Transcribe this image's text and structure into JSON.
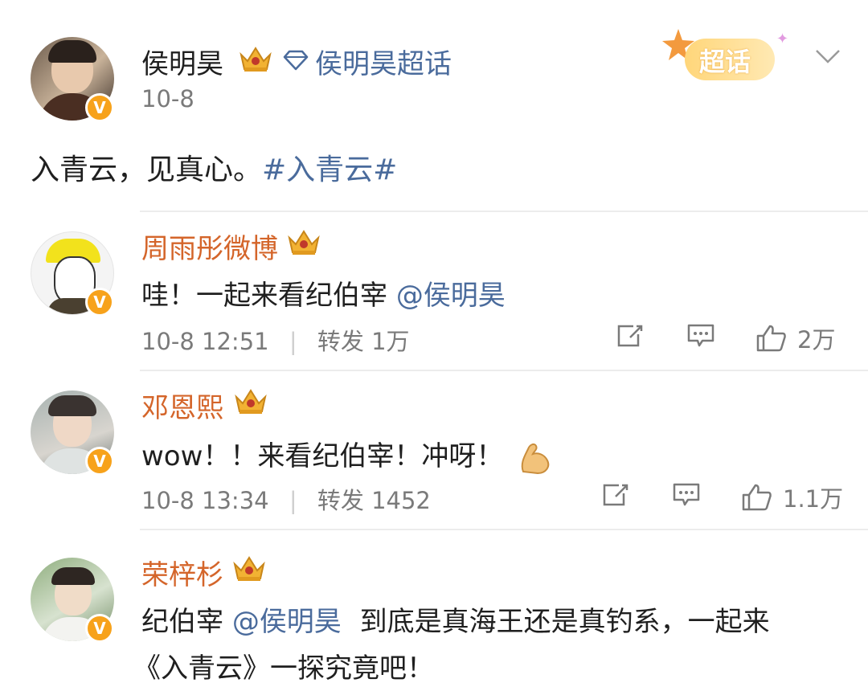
{
  "post": {
    "author": "侯明昊",
    "supertopic": "侯明昊超话",
    "date": "10-8",
    "text_plain": "入青云，见真心。",
    "hashtag": "#入青云#",
    "supertopic_badge": "超话"
  },
  "comments": [
    {
      "name": "周雨彤微博",
      "text_prefix": "哇！一起来看纪伯宰 ",
      "mention": "@侯明昊",
      "time": "10-8 12:51",
      "separator": "|",
      "repost_label": "转发",
      "repost_count": "1万",
      "likes": "2万"
    },
    {
      "name": "邓恩熙",
      "text_prefix": "wow！！来看纪伯宰！冲呀！",
      "time": "10-8 13:34",
      "separator": "|",
      "repost_label": "转发",
      "repost_count": "1452",
      "likes": "1.1万"
    },
    {
      "name": "荣梓杉",
      "text_prefix": "纪伯宰 ",
      "mention": "@侯明昊",
      "text_suffix": "到底是真海王还是真钓系，一起来",
      "text_line2": "《入青云》一探究竟吧！"
    }
  ],
  "icons": {
    "verified": "V",
    "crown": "crown-icon",
    "diamond": "diamond-icon",
    "chevron": "chevron-down-icon",
    "share": "share-icon",
    "comment": "comment-icon",
    "like": "like-icon"
  },
  "colors": {
    "name_orange": "#d4652a",
    "link_blue": "#4a6b9c",
    "meta_gray": "#7a7a7a",
    "verified_orange": "#f7a21b"
  }
}
